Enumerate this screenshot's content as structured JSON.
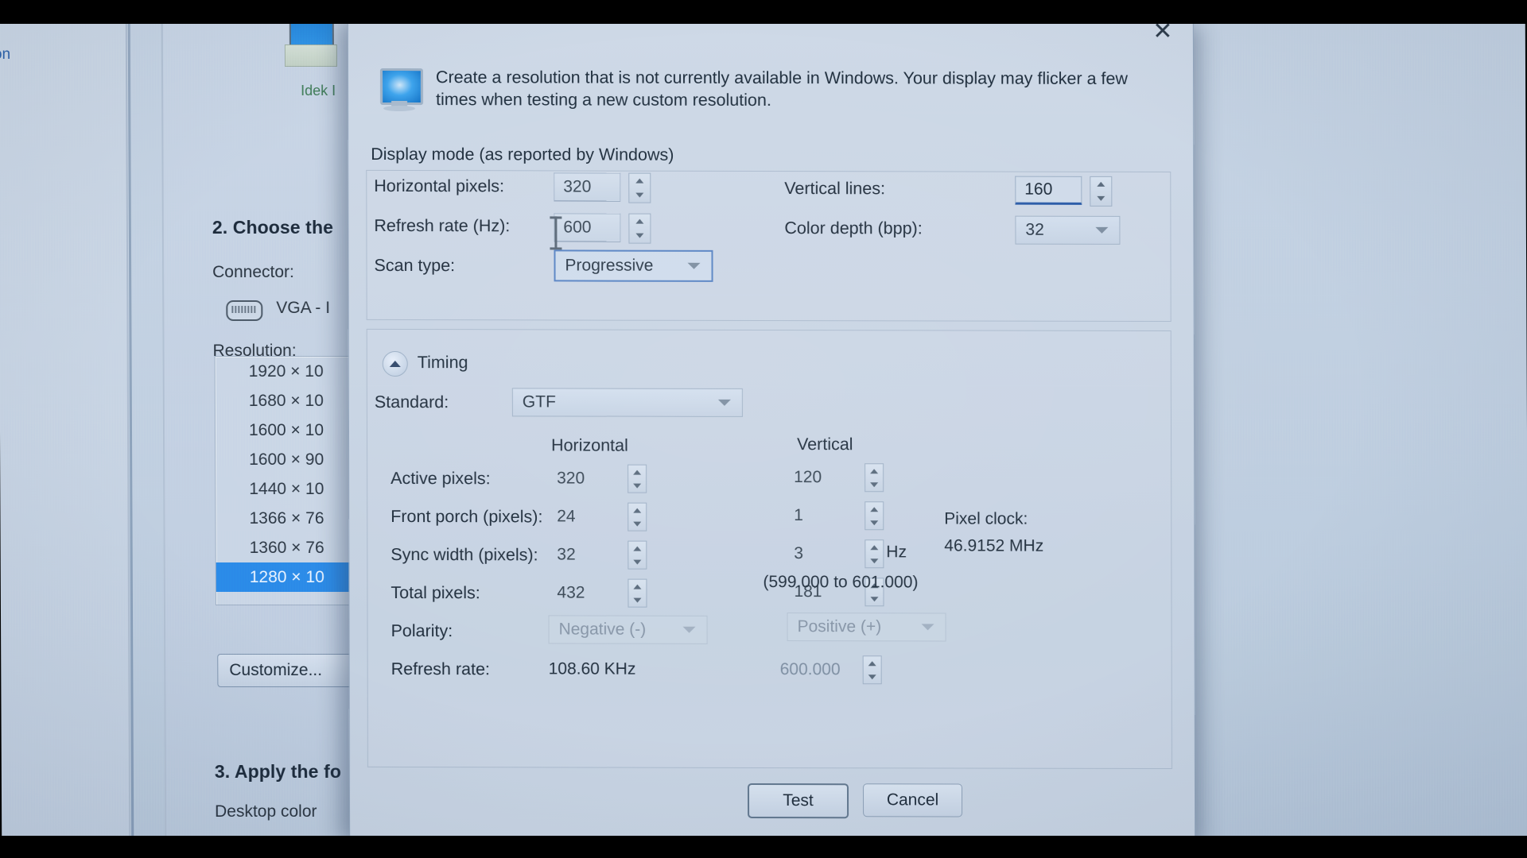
{
  "background_window": {
    "side_link": "on",
    "monitor_thumb_caption": "Idek I",
    "step2_heading": "2. Choose the",
    "connector_label": "Connector:",
    "connector_value": "VGA - I",
    "resolution_label": "Resolution:",
    "resolution_items": [
      {
        "label": "1920 × 10",
        "selected": false
      },
      {
        "label": "1680 × 10",
        "selected": false
      },
      {
        "label": "1600 × 10",
        "selected": false
      },
      {
        "label": "1600 × 90",
        "selected": false
      },
      {
        "label": "1440 × 10",
        "selected": false
      },
      {
        "label": "1366 × 76",
        "selected": false
      },
      {
        "label": "1360 × 76",
        "selected": false
      },
      {
        "label": "1280 × 10",
        "selected": true
      }
    ],
    "customize_button": "Customize...",
    "step3_heading": "3. Apply the fo",
    "desktop_color_label": "Desktop color"
  },
  "dialog": {
    "close_icon": "✕",
    "icon_name": "monitor-icon",
    "description": "Create a resolution that is not currently available in Windows. Your display may flicker a few times when testing a new custom resolution.",
    "display_mode": {
      "group_title": "Display mode (as reported by Windows)",
      "horizontal_pixels_label": "Horizontal pixels:",
      "horizontal_pixels_value": "320",
      "vertical_lines_label": "Vertical lines:",
      "vertical_lines_value": "160",
      "refresh_rate_label": "Refresh rate (Hz):",
      "refresh_rate_value": "600",
      "color_depth_label": "Color depth (bpp):",
      "color_depth_value": "32",
      "scan_type_label": "Scan type:",
      "scan_type_value": "Progressive"
    },
    "timing": {
      "section_title": "Timing",
      "standard_label": "Standard:",
      "standard_value": "GTF",
      "col_horizontal": "Horizontal",
      "col_vertical": "Vertical",
      "rows": [
        {
          "label": "Active pixels:",
          "horizontal": "320",
          "vertical": "120"
        },
        {
          "label": "Front porch (pixels):",
          "horizontal": "24",
          "vertical": "1"
        },
        {
          "label": "Sync width (pixels):",
          "horizontal": "32",
          "vertical": "3"
        },
        {
          "label": "Total pixels:",
          "horizontal": "432",
          "vertical": "181"
        },
        {
          "label": "Polarity:",
          "horizontal": "Negative (-)",
          "vertical": "Positive (+)"
        },
        {
          "label": "Refresh rate:",
          "horizontal": "108.60 KHz",
          "vertical": "600.000"
        }
      ],
      "refresh_unit": "Hz",
      "refresh_range": "(599.000 to 601.000)",
      "pixel_clock_label": "Pixel clock:",
      "pixel_clock_value": "46.9152 MHz"
    },
    "footer": {
      "test_button": "Test",
      "cancel_button": "Cancel"
    }
  },
  "colors": {
    "dialog_bg": "#c9d5e4",
    "selection_blue": "#2a8ae8",
    "focus_underline": "#2b5ca8",
    "link_blue": "#2a5fa8",
    "disabled_text": "#7e8fa2"
  }
}
